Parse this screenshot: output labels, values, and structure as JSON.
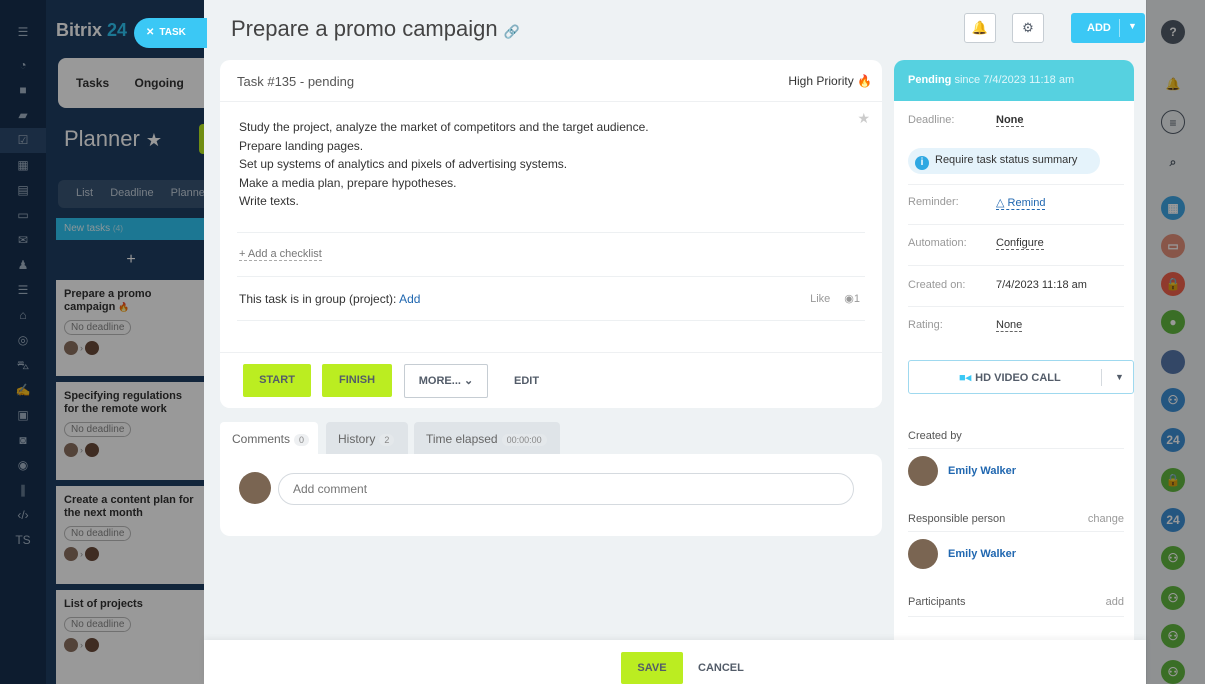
{
  "leftbar": {
    "icons": [
      "menu-icon",
      "pulse-icon",
      "chat-icon",
      "messenger-icon",
      "tasks-icon",
      "calendar-icon",
      "documents-icon",
      "drive-icon",
      "mail-icon",
      "groups-icon",
      "filter-icon",
      "company-icon",
      "target-icon",
      "shop-icon",
      "sign-icon",
      "contacts-icon",
      "robot-icon",
      "database-icon",
      "marketing-icon",
      "code-icon",
      "ts-icon"
    ],
    "ts_label": "TS"
  },
  "leftpanel": {
    "brand": "Bitrix",
    "brand_num": "24",
    "tabs": [
      "Tasks",
      "Ongoing"
    ],
    "planner": "Planner",
    "views": [
      "List",
      "Deadline",
      "Planner"
    ],
    "column_title": "New tasks",
    "column_count": "(4)",
    "add_symbol": "+",
    "cards": [
      {
        "title": "Prepare a promo campaign",
        "deadline": "No deadline"
      },
      {
        "title": "Specifying regulations for the remote work",
        "deadline": "No deadline"
      },
      {
        "title": "Create a content plan for the next month",
        "deadline": "No deadline"
      },
      {
        "title": "List of projects",
        "deadline": "No deadline"
      }
    ]
  },
  "closetab": {
    "icon": "✕",
    "label": "TASK"
  },
  "header": {
    "title": "Prepare a promo campaign",
    "add_label": "ADD"
  },
  "task": {
    "number_status": "Task #135 - pending",
    "priority": "High Priority",
    "description": [
      "Study the project, analyze the market of competitors and the target audience.",
      "Prepare landing pages.",
      "Set up systems of analytics and pixels of advertising systems.",
      "Make a media plan, prepare hypotheses.",
      "Write texts."
    ],
    "add_checklist": "+ Add a checklist",
    "group_text": "This task is in group (project):",
    "group_add": "Add",
    "like": "Like",
    "views": "1",
    "buttons": {
      "start": "START",
      "finish": "FINISH",
      "more": "MORE...",
      "edit": "EDIT"
    }
  },
  "comments": {
    "tabs": [
      {
        "label": "Comments",
        "count": "0"
      },
      {
        "label": "History",
        "count": "2"
      },
      {
        "label": "Time elapsed",
        "count": "00:00:00"
      }
    ],
    "placeholder": "Add comment"
  },
  "sidebar": {
    "status": "Pending",
    "since": "since 7/4/2023 11:18 am",
    "deadline_label": "Deadline:",
    "deadline_value": "None",
    "summary": "Require task status summary",
    "reminder_label": "Reminder:",
    "reminder_value": "Remind",
    "automation_label": "Automation:",
    "automation_value": "Configure",
    "created_on_label": "Created on:",
    "created_on_value": "7/4/2023 11:18 am",
    "rating_label": "Rating:",
    "rating_value": "None",
    "video_call": "HD VIDEO CALL",
    "created_by_label": "Created by",
    "creator": "Emily Walker",
    "responsible_label": "Responsible person",
    "responsible_change": "change",
    "responsible": "Emily Walker",
    "participants_label": "Participants",
    "participants_add": "add"
  },
  "footer": {
    "save": "SAVE",
    "cancel": "CANCEL"
  },
  "rightbar": {
    "num_badge": "24"
  },
  "colors": {
    "accent_blue": "#3bc8f5",
    "green": "#bbed21",
    "status_head": "#56d1e0",
    "link": "#2067b0",
    "sidebar_dark": "#16304f"
  }
}
